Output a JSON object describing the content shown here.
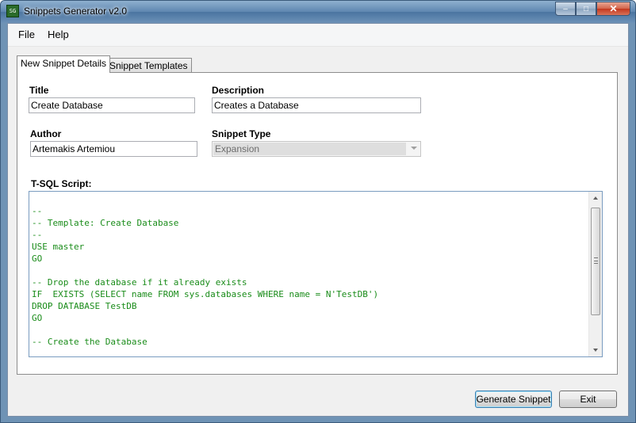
{
  "window": {
    "title": "Snippets Generator v2.0",
    "icon": "app-icon",
    "icon_text": "SG"
  },
  "menu": {
    "file": "File",
    "help": "Help"
  },
  "tabs": [
    {
      "label": "New Snippet Details",
      "active": true
    },
    {
      "label": "Snippet Templates",
      "active": false
    }
  ],
  "form": {
    "title_label": "Title",
    "title_value": "Create Database",
    "description_label": "Description",
    "description_value": "Creates a Database",
    "author_label": "Author",
    "author_value": "Artemakis Artemiou",
    "snippet_type_label": "Snippet Type",
    "snippet_type_value": "Expansion",
    "script_label": "T-SQL Script:",
    "script_lines": [
      "--",
      "-- Template: Create Database",
      "--",
      "USE master",
      "GO",
      "",
      "-- Drop the database if it already exists",
      "IF  EXISTS (SELECT name FROM sys.databases WHERE name = N'TestDB')",
      "DROP DATABASE TestDB",
      "GO",
      "",
      "-- Create the Database"
    ]
  },
  "buttons": {
    "generate": "Generate Snippet",
    "exit": "Exit"
  },
  "colors": {
    "code_text": "#1a8c1a",
    "titlebar": "#5e86b0"
  }
}
